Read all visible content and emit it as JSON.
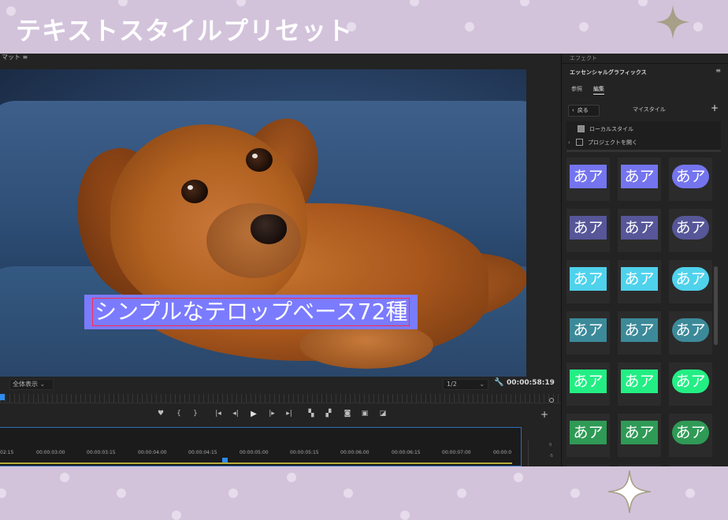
{
  "banner": {
    "title": "テキストスタイルプリセット"
  },
  "monitor": {
    "tab_label": "マット ≡",
    "caption": "シンプルなテロップベース72種",
    "zoom": "全体表示",
    "resolution": "1/2",
    "timecode": "00:00:58:19"
  },
  "timeline": {
    "ticks": [
      "02:15",
      "00:00:03:00",
      "00:00:03:15",
      "00:00:04:00",
      "00:00:04:15",
      "00:00:05:00",
      "00:00:05:15",
      "00:00:06:00",
      "00:00:06:15",
      "00:00:07:00",
      "00:00:0"
    ],
    "meter_labels": [
      "0",
      "-5"
    ]
  },
  "panel": {
    "effects_label": "エフェクト",
    "title": "エッセンシャルグラフィックス",
    "tabs": [
      "参照",
      "編集"
    ],
    "back_label": "戻る",
    "my_style_label": "マイスタイル",
    "tree": [
      {
        "label": "ローカルスタイル",
        "checked": true
      },
      {
        "label": "プロジェクトを開く",
        "checked": false
      }
    ],
    "style_text": "あア",
    "style_rows": [
      [
        "#7474ee",
        "#7474ee",
        "#7474ee"
      ],
      [
        "#565699",
        "#565699",
        "#565699"
      ],
      [
        "#4fd2ec",
        "#4fd2ec",
        "#4fd2ec"
      ],
      [
        "#3c8a99",
        "#3c8a99",
        "#3c8a99"
      ],
      [
        "#23ee84",
        "#23ee84",
        "#23ee84"
      ],
      [
        "#2f9a56",
        "#2f9a56",
        "#2f9a56"
      ]
    ]
  },
  "icons": {
    "sparkle": "sparkle-icon",
    "menu": "hamburger-icon"
  }
}
